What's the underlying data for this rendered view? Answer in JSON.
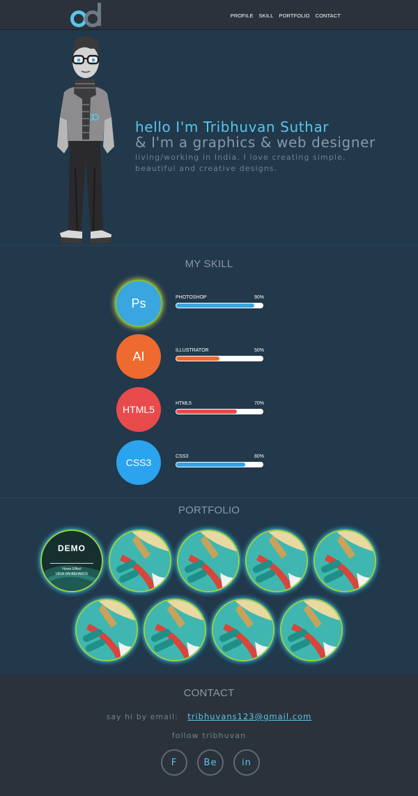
{
  "header": {
    "nav": [
      "PROFILE",
      "SKILL",
      "PORTFOLIO",
      "CONTACT"
    ]
  },
  "hero": {
    "greeting": "hello I'm Tribhuvan Suthar",
    "role": "& I'm a graphics & web designer",
    "description": "living/working in India. I love creating simple, beautiful and creative designs."
  },
  "skills": {
    "title": "MY SKILL",
    "items": [
      {
        "icon_label": "Ps",
        "name": "PHOTOSHOP",
        "percent_text": "90%",
        "level": 0.9,
        "color": "#3aa6df"
      },
      {
        "icon_label": "AI",
        "name": "ILLUSTRATOR",
        "percent_text": "50%",
        "level": 0.5,
        "color": "#ee6a2f"
      },
      {
        "icon_label": "HTML5",
        "name": "HTML5",
        "percent_text": "70%",
        "level": 0.7,
        "color": "#e94b4c"
      },
      {
        "icon_label": "CSS3",
        "name": "CSS3",
        "percent_text": "80%",
        "level": 0.8,
        "color": "#2ba3ee"
      }
    ]
  },
  "portfolio": {
    "title": "PORTFOLIO",
    "demo": {
      "title": "DEMO",
      "subtitle": "Hover Effect",
      "link": "VIEW ON BEHANCE"
    }
  },
  "contact": {
    "title": "CONTACT",
    "email_label": "say hi by email:",
    "email": "tribhuvans123@gmail.com",
    "follow_label": "follow tribhuvan",
    "social": [
      "F",
      "Be",
      "in"
    ]
  },
  "colors": {
    "accent": "#5bc6ea",
    "background": "#22384b",
    "header_bg": "#2b323b"
  }
}
